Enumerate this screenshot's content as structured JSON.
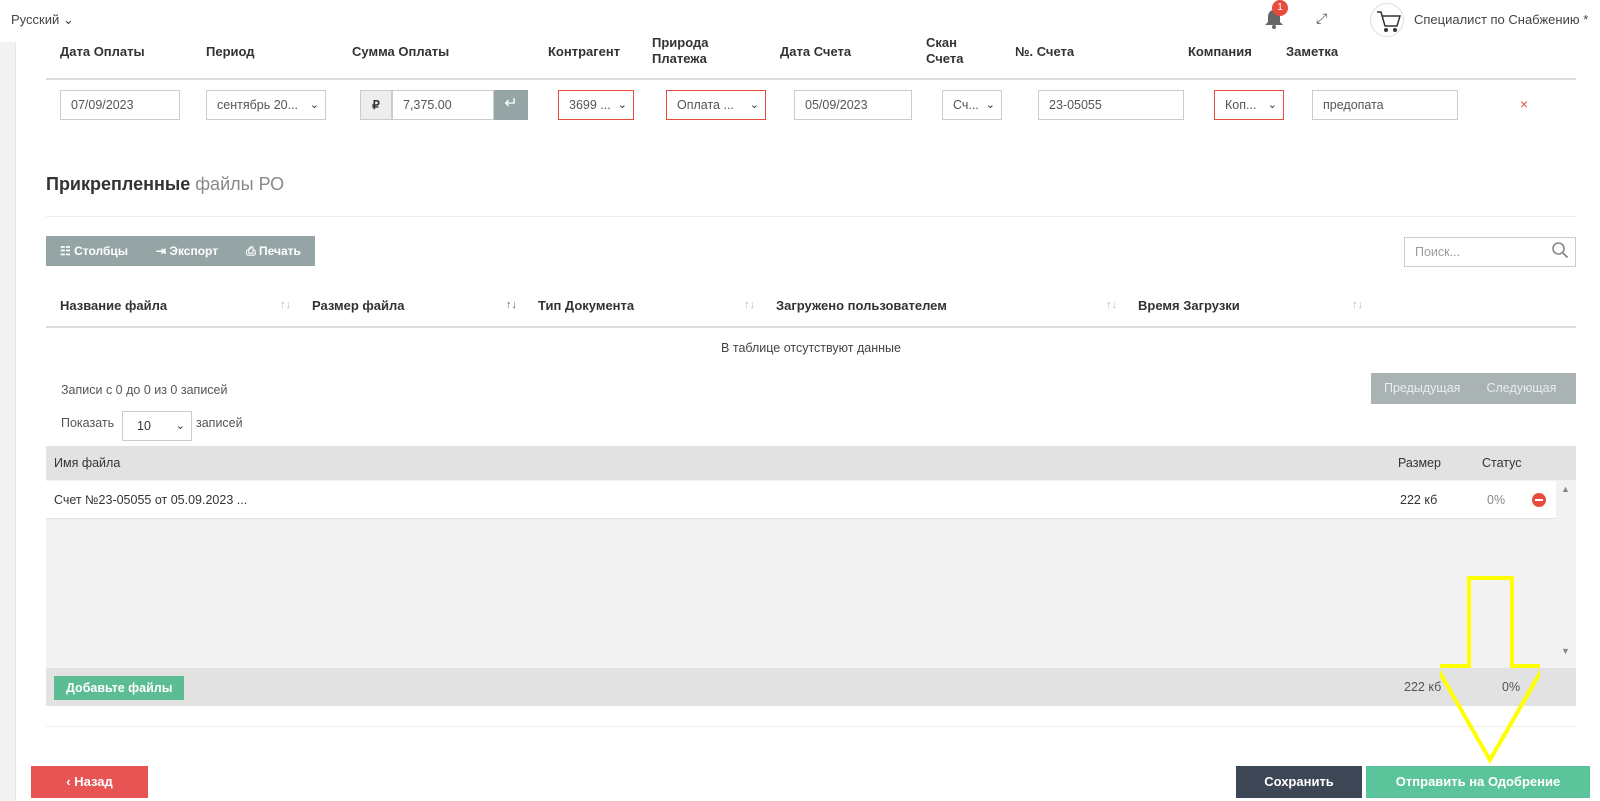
{
  "topbar": {
    "language": "Русский",
    "notifications_count": "1",
    "user_name": "Специалист по Снабжению *"
  },
  "payment_table": {
    "headers": {
      "date": "Дата Оплаты",
      "period": "Период",
      "amount": "Сумма Оплаты",
      "contractor": "Контрагент",
      "nature_1": "Природа",
      "nature_2": "Платежа",
      "invoice_date": "Дата Счета",
      "scan_1": "Скан",
      "scan_2": "Счета",
      "invoice_no": "№. Счета",
      "company": "Компания",
      "note": "Заметка"
    },
    "row": {
      "date": "07/09/2023",
      "period": "сентябрь 20...",
      "currency": "₽",
      "amount": "7,375.00",
      "contractor": "3699 ...",
      "nature": "Оплата ...",
      "invoice_date": "05/09/2023",
      "scan": "Сч...",
      "invoice_no": "23-05055",
      "company": "Коп...",
      "note": "предопата",
      "delete": "×"
    }
  },
  "attached": {
    "title_bold": "Прикрепленные",
    "title_light": "файлы РО",
    "toolbar": {
      "columns": "Столбцы",
      "export": "Экспорт",
      "print": "Печать"
    },
    "search_placeholder": "Поиск...",
    "columns": [
      "Название файла",
      "Размер файла",
      "Тип Документа",
      "Загружено пользователем",
      "Время Загрузки"
    ],
    "empty": "В таблице отсутствуют данные",
    "records_info": "Записи с 0 до 0 из 0 записей",
    "prev": "Предыдущая",
    "next": "Следующая",
    "show_label": "Показать",
    "show_value": "10",
    "show_suffix": "записей"
  },
  "uploader": {
    "col_name": "Имя файла",
    "col_size": "Размер",
    "col_status": "Статус",
    "file": {
      "name": "Счет №23-05055 от 05.09.2023 ...",
      "size": "222 кб",
      "status": "0%"
    },
    "add_label": "Добавьте файлы",
    "total_size": "222 кб",
    "total_status": "0%"
  },
  "actions": {
    "back": "Назад",
    "save": "Сохранить",
    "send": "Отправить на Одобрение"
  },
  "colors": {
    "danger": "#e85454",
    "dark": "#3d4654",
    "success": "#5cc49a",
    "annotation_arrow": "#ffff00"
  }
}
